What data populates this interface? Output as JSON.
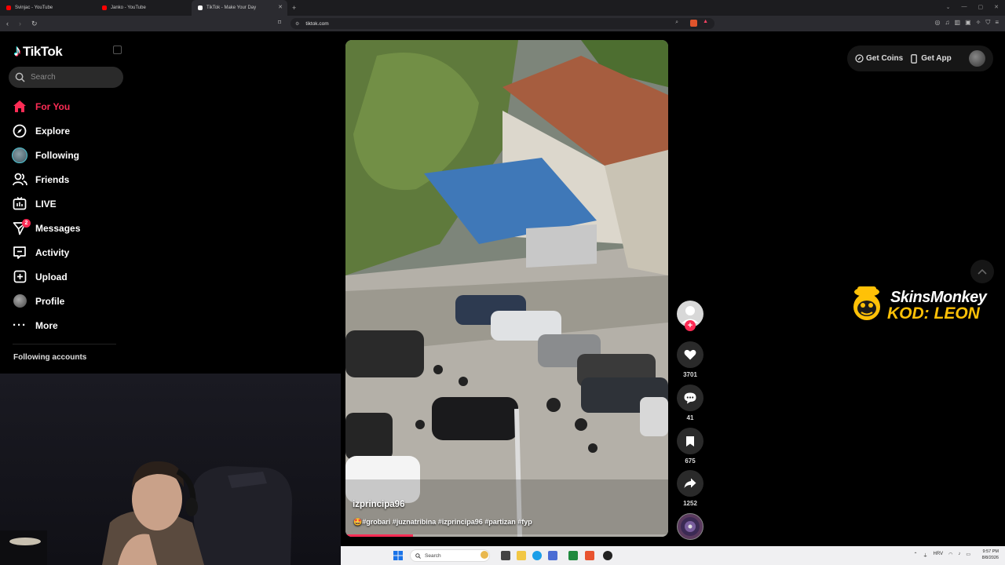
{
  "browser": {
    "tabs": [
      {
        "title": "Svinjac - YouTube",
        "color": "#ff0000"
      },
      {
        "title": "Janko - YouTube",
        "color": "#ff0000"
      },
      {
        "title": "TikTok - Make Your Day",
        "color": "#ffffff"
      }
    ],
    "active_tab": 2,
    "url": "tiktok.com"
  },
  "tiktok": {
    "brand": "TikTok",
    "search_placeholder": "Search",
    "nav": [
      {
        "label": "For You",
        "icon": "home-icon",
        "active": true
      },
      {
        "label": "Explore",
        "icon": "compass-icon"
      },
      {
        "label": "Following",
        "icon": "following-avatar-icon"
      },
      {
        "label": "Friends",
        "icon": "friends-icon"
      },
      {
        "label": "LIVE",
        "icon": "live-icon"
      },
      {
        "label": "Messages",
        "icon": "messages-icon",
        "badge": "2"
      },
      {
        "label": "Activity",
        "icon": "activity-icon"
      },
      {
        "label": "Upload",
        "icon": "upload-icon"
      },
      {
        "label": "Profile",
        "icon": "profile-avatar-icon"
      },
      {
        "label": "More",
        "icon": "more-icon"
      }
    ],
    "following_accounts_label": "Following accounts",
    "top_right": {
      "coins": "Get Coins",
      "app": "Get App"
    },
    "video": {
      "username": "izprincipa96",
      "description": "🤩#grobari #juznatribina #izprincipa96 #partizan #fyp",
      "progress": 0.21
    },
    "actions": {
      "likes": "3701",
      "comments": "41",
      "saves": "675",
      "shares": "1252"
    },
    "accent": "#fe2c55"
  },
  "overlay": {
    "sponsor_line1": "SkinsMonkey",
    "sponsor_line2": "KOD: LEON"
  },
  "taskbar": {
    "search": "Search",
    "lang": "HRV",
    "time": "9:57 PM",
    "date": "8/8/2026"
  }
}
